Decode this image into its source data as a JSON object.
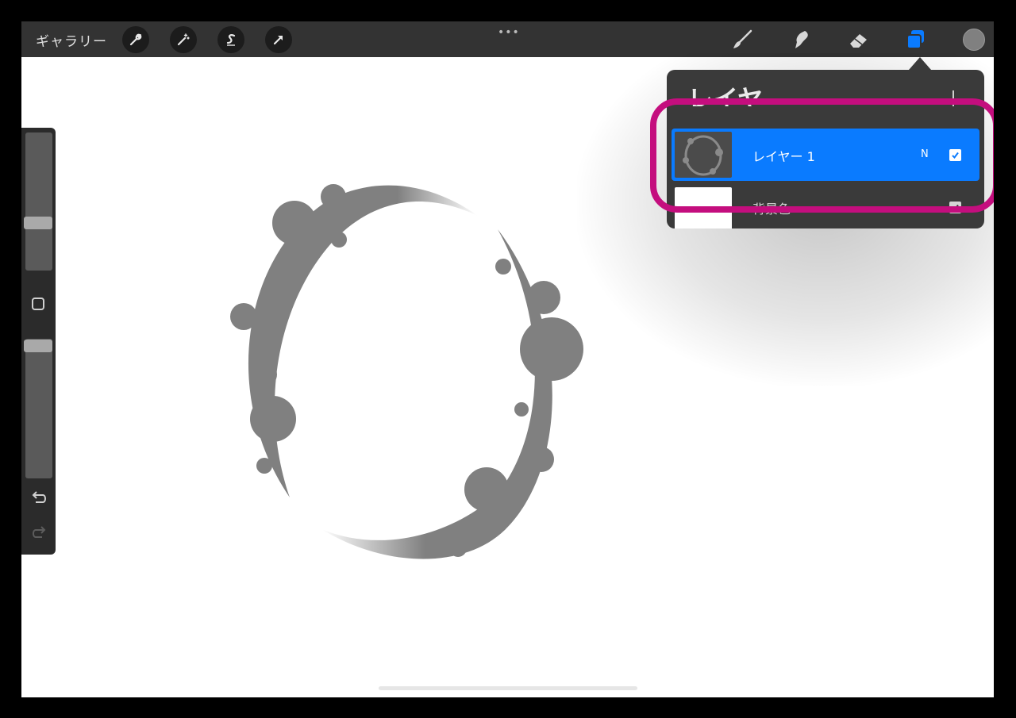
{
  "toolbar": {
    "gallery_label": "ギャラリー",
    "more_dots": "•••",
    "left_tools": [
      "wrench-icon",
      "magic-wand-icon",
      "selection-s-icon",
      "arrow-transform-icon"
    ],
    "right_tools": [
      "brush-icon",
      "smudge-icon",
      "eraser-icon",
      "layers-icon"
    ],
    "active_tool": "layers",
    "current_color": "#808080"
  },
  "sidebar": {
    "brush_size_level": 0.35,
    "opacity_level": 0.02,
    "undo_icon": "undo-arrow-icon",
    "redo_icon": "redo-arrow-icon"
  },
  "layers_panel": {
    "title": "レイヤ",
    "add_icon": "plus-icon",
    "layers": [
      {
        "name": "レイヤー 1",
        "blend_mode": "N",
        "visible": true,
        "selected": true
      },
      {
        "name": "背景色",
        "visible": true,
        "selected": false
      }
    ]
  },
  "colors": {
    "toolbar_bg": "#333333",
    "panel_bg": "#3a3a3a",
    "selected_layer": "#0a7bff",
    "highlight_ring": "#c40e7e",
    "stroke_gray": "#808080"
  }
}
